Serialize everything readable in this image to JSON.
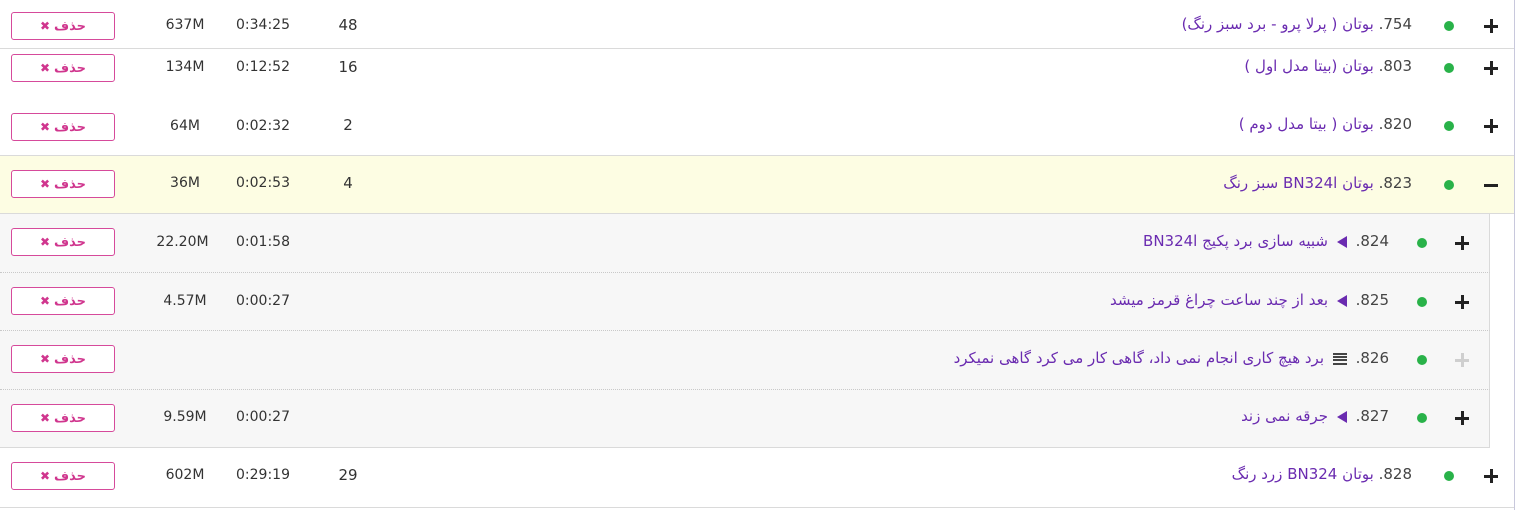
{
  "delete_label": "حذف",
  "colors": {
    "title": "#6a2bb0",
    "status_dot": "#29b249",
    "delete_border": "#d64a9b",
    "expanded_bg": "#fdfde3",
    "child_bg": "#f7f7f7"
  },
  "rows": [
    {
      "number": "754.",
      "title": "بوتان ( پرلا پرو - برد سبز رنگ)",
      "count": "48",
      "duration": "0:34:25",
      "size": "637M",
      "toggle": "plus"
    },
    {
      "number": "803.",
      "title": "بوتان (بیتا مدل اول )",
      "count": "16",
      "duration": "0:12:52",
      "size": "134M",
      "toggle": "plus"
    },
    {
      "number": "820.",
      "title": "بوتان ( بیتا مدل دوم )",
      "count": "2",
      "duration": "0:02:32",
      "size": "64M",
      "toggle": "plus"
    },
    {
      "number": "823.",
      "title": "بوتان BN324l سبز رنگ",
      "count": "4",
      "duration": "0:02:53",
      "size": "36M",
      "toggle": "minus"
    },
    {
      "number": "824.",
      "title": "شبیه سازی برد پکیج BN324l",
      "duration": "0:01:58",
      "size": "22.20M",
      "icon": "play-icon",
      "toggle": "plus"
    },
    {
      "number": "825.",
      "title": "بعد از چند ساعت چراغ قرمز میشد",
      "duration": "0:00:27",
      "size": "4.57M",
      "icon": "play-icon",
      "toggle": "plus"
    },
    {
      "number": "826.",
      "title": "برد هیچ کاری انجام نمی داد، گاهی کار می کرد گاهی نمیکرد",
      "icon": "text-icon",
      "toggle": "plus-disabled"
    },
    {
      "number": "827.",
      "title": "جرقه نمی زند",
      "duration": "0:00:27",
      "size": "9.59M",
      "icon": "play-icon",
      "toggle": "plus"
    },
    {
      "number": "828.",
      "title": "بوتان BN324 زرد رنگ",
      "count": "29",
      "duration": "0:29:19",
      "size": "602M",
      "toggle": "plus"
    }
  ]
}
